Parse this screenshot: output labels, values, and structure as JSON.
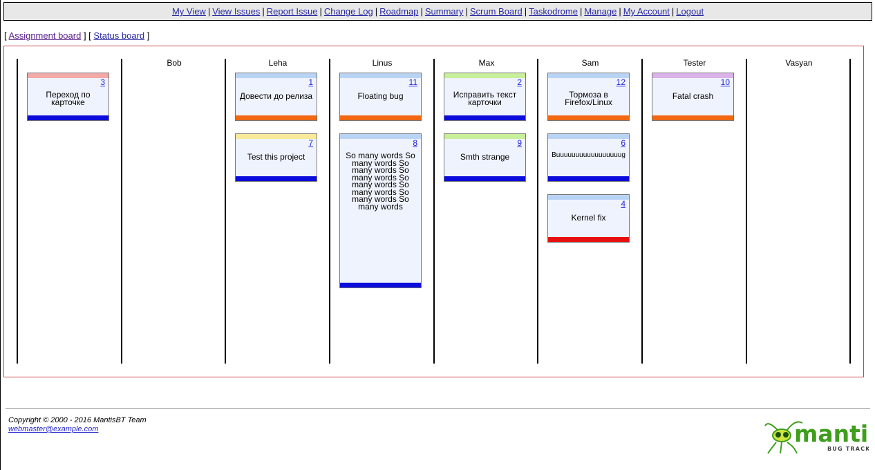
{
  "menu": {
    "items": [
      "My View",
      "View Issues",
      "Report Issue",
      "Change Log",
      "Roadmap",
      "Summary",
      "Scrum Board",
      "Taskodrome",
      "Manage",
      "My Account",
      "Logout"
    ],
    "separator": "|"
  },
  "subnav": {
    "open_bracket": "[",
    "middle": "] [",
    "close_bracket": "]",
    "assignment_board": "Assignment board",
    "status_board": "Status board"
  },
  "board": {
    "columns": [
      "",
      "Bob",
      "Leha",
      "Linus",
      "Max",
      "Sam",
      "Tester",
      "Vasyan"
    ],
    "cards": [
      {
        "id": "3",
        "summary": "Переход по карточке",
        "column": "",
        "top_color": "#f4a9a9",
        "bottom_color": "#0b0bdc"
      },
      {
        "id": "1",
        "summary": "Довести до релиза",
        "column": "Leha",
        "top_color": "#b9d3f5",
        "bottom_color": "#f26711"
      },
      {
        "id": "7",
        "summary": "Test this project",
        "column": "Leha",
        "top_color": "#f8ea9a",
        "bottom_color": "#0b0bdc"
      },
      {
        "id": "11",
        "summary": "Floating bug",
        "column": "Linus",
        "top_color": "#b9d3f5",
        "bottom_color": "#f26711"
      },
      {
        "id": "8",
        "summary": "So many words So many words So many words So many words So many words So many words So many words So many words",
        "column": "Linus",
        "top_color": "#b9d3f5",
        "bottom_color": "#0b0bdc"
      },
      {
        "id": "2",
        "summary": "Исправить текст карточки",
        "column": "Max",
        "top_color": "#c8ef9a",
        "bottom_color": "#0b0bdc"
      },
      {
        "id": "9",
        "summary": "Smth strange",
        "column": "Max",
        "top_color": "#c8ef9a",
        "bottom_color": "#0b0bdc"
      },
      {
        "id": "12",
        "summary": "Тормоза в Firefox/Linux",
        "column": "Sam",
        "top_color": "#b9d3f5",
        "bottom_color": "#f26711"
      },
      {
        "id": "6",
        "summary": "Buuuuuuuuuuuuuuuuug",
        "column": "Sam",
        "top_color": "#b9d3f5",
        "bottom_color": "#0b0bdc"
      },
      {
        "id": "4",
        "summary": "Kernel fix",
        "column": "Sam",
        "top_color": "#b9d3f5",
        "bottom_color": "#e61010"
      },
      {
        "id": "10",
        "summary": "Fatal crash",
        "column": "Tester",
        "top_color": "#dcb2ea",
        "bottom_color": "#f26711"
      }
    ]
  },
  "footer": {
    "copyright": "Copyright © 2000 - 2016 MantisBT Team",
    "email": "webmaster@example.com",
    "logo_alt": "mantis BUG TRACKER",
    "logo_word": "mantis",
    "logo_sub": "BUG TRACKER"
  },
  "colors": {
    "link": "#2929a3",
    "board_border": "#cc4444",
    "logo_green": "#3f9e1d"
  }
}
